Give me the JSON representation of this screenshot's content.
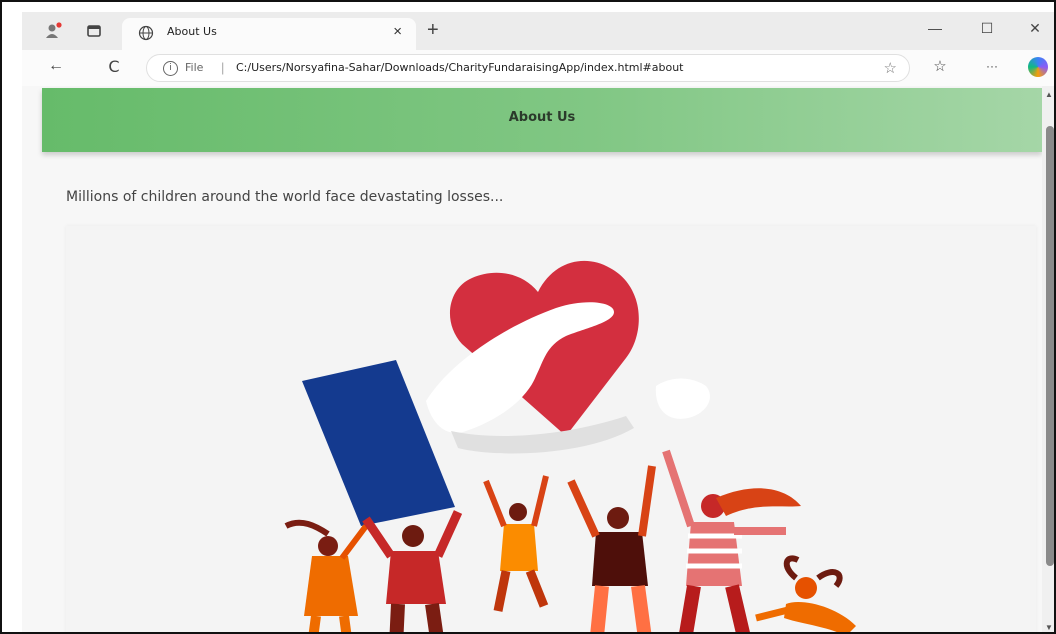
{
  "browser": {
    "tab": {
      "title": "About Us",
      "close_glyph": "×"
    },
    "new_tab_glyph": "+",
    "window_controls": {
      "minimize": "—",
      "maximize": "☐",
      "close": "✕"
    },
    "nav": {
      "back": "←",
      "refresh": "C",
      "more": "···"
    },
    "address": {
      "info_glyph": "i",
      "scheme_label": "File",
      "separator": "|",
      "url": "C:/Users/Norsyafina-Sahar/Downloads/CharityFundaraisingApp/index.html#about"
    },
    "icons": [
      "profile-icon",
      "tab-actions-icon",
      "globe-icon",
      "info-icon",
      "favorite-star-icon",
      "favorites-icon",
      "copilot-icon"
    ]
  },
  "page": {
    "header_title": "About Us",
    "intro_text": "Millions of children around the world face devastating losses...",
    "illustration": "heart-donation-crowd"
  },
  "colors": {
    "header_gradient_start": "#66bb6a",
    "header_gradient_end": "#a5d6a7",
    "heart": "#d32f3f",
    "box": "#143a8f"
  }
}
